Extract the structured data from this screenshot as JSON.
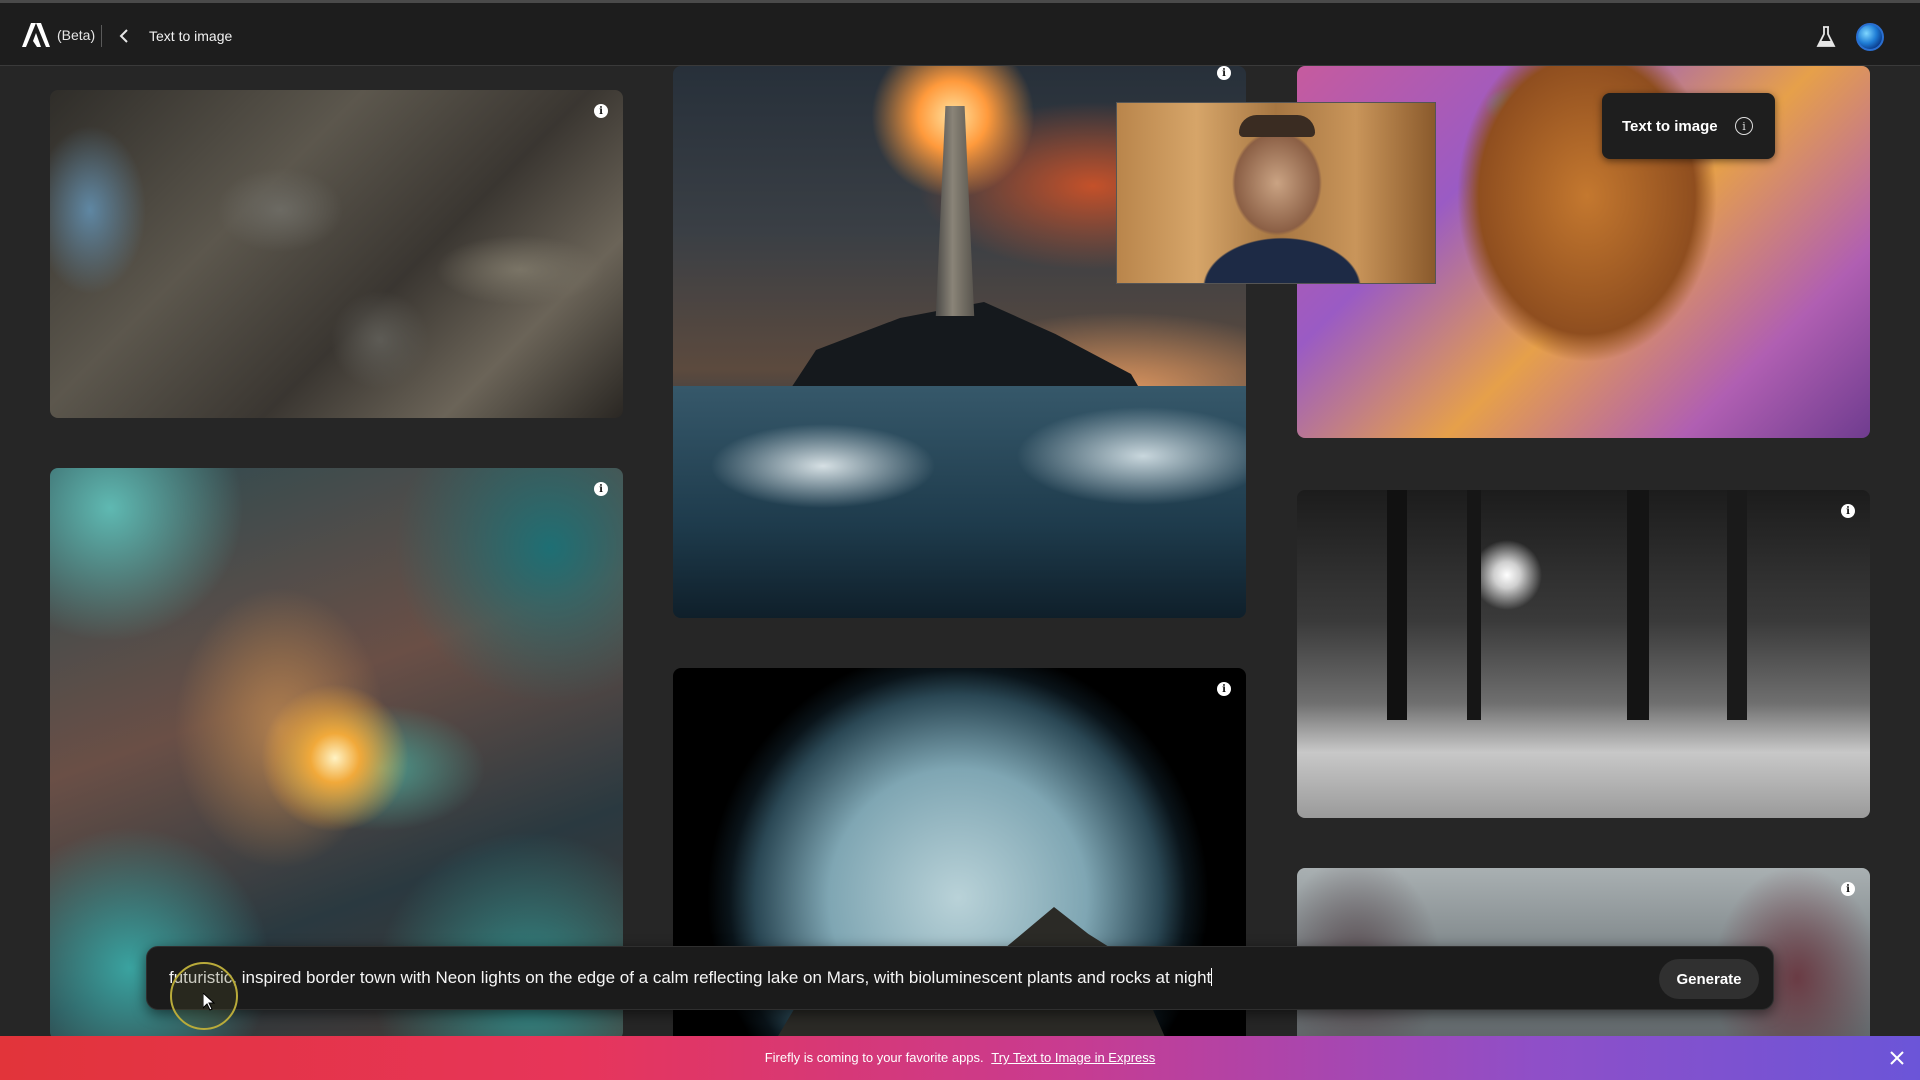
{
  "header": {
    "beta_label": "(Beta)",
    "breadcrumb": "Text to image",
    "logo_icon": "adobe-logo-icon",
    "back_icon": "chevron-left-icon",
    "labs_icon": "flask-icon",
    "avatar_icon": "user-avatar"
  },
  "gallery": {
    "info_glyph": "i",
    "cards": [
      {
        "name": "engine-image"
      },
      {
        "name": "fractal-image"
      },
      {
        "name": "lighthouse-image"
      },
      {
        "name": "portrait-image"
      },
      {
        "name": "forest-image"
      },
      {
        "name": "bowl-image"
      },
      {
        "name": "city-image"
      }
    ]
  },
  "tooltip": {
    "label": "Text to image",
    "info_glyph": "i"
  },
  "prompt": {
    "value": "futuristic, inspired border town with Neon lights on the edge of a calm reflecting lake on Mars, with bioluminescent plants and rocks at night",
    "button": "Generate"
  },
  "banner": {
    "text": "Firefly is coming to your favorite apps.",
    "link": "Try Text to Image in Express",
    "close_icon": "close-icon",
    "colors": [
      "#e2343a",
      "#c93b8f",
      "#6b55d8"
    ]
  },
  "colors": {
    "page_bg": "#262626",
    "header_bg": "#1d1d1d",
    "prompt_bg": "#1b1b1b"
  }
}
